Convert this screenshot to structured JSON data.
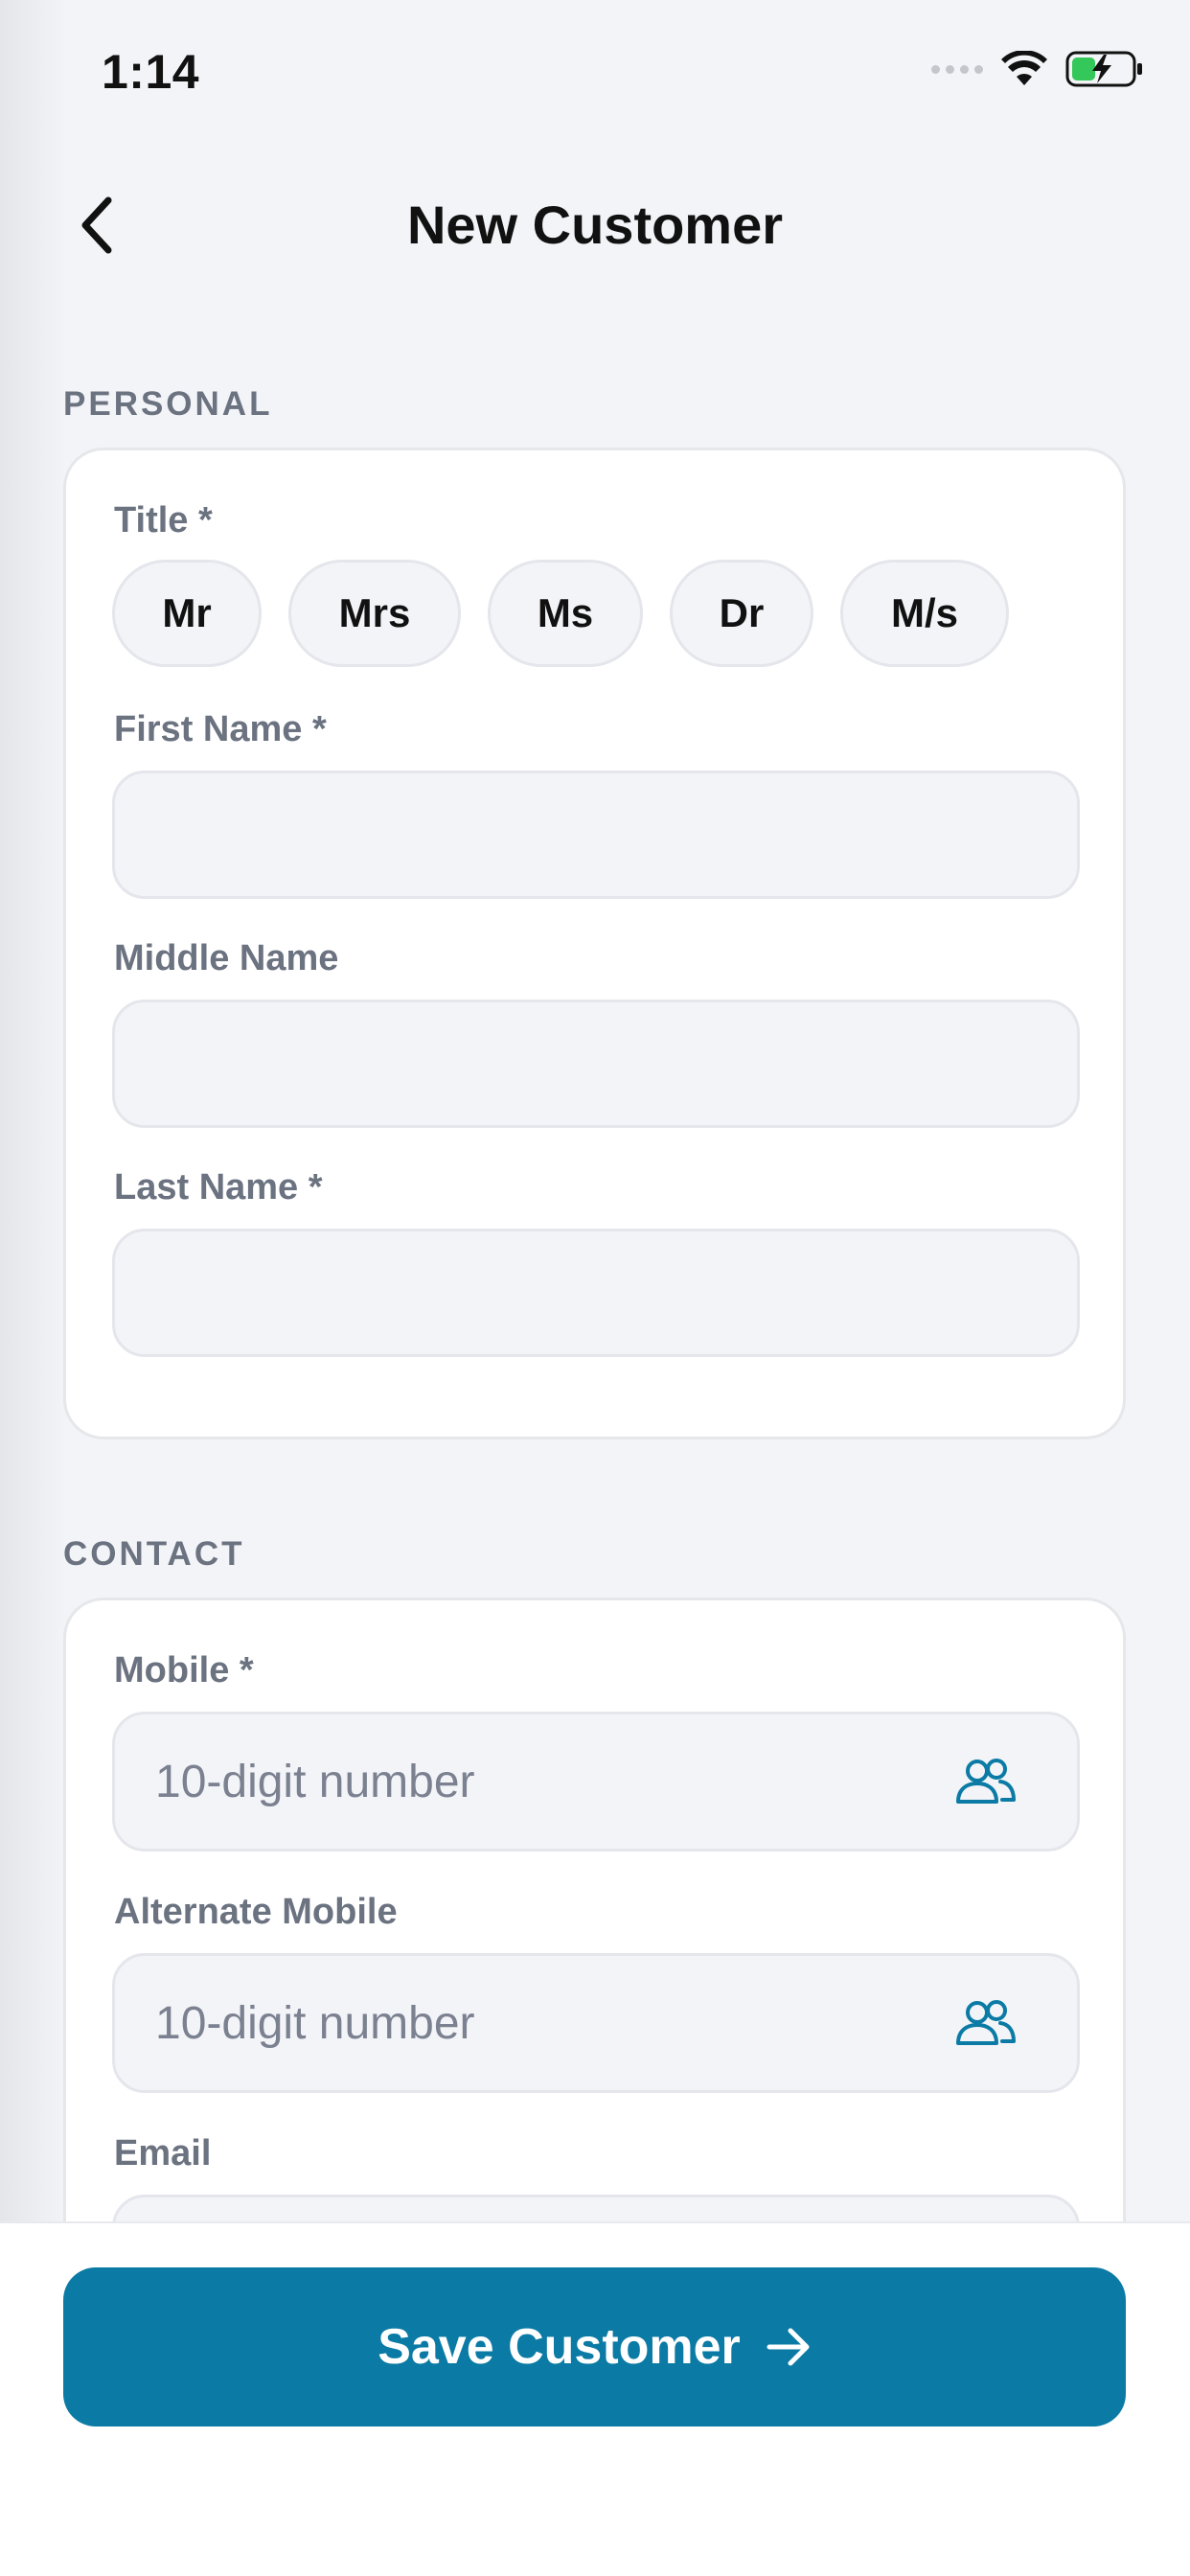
{
  "status_bar": {
    "time": "1:14"
  },
  "header": {
    "title": "New Customer",
    "back_icon": "chevron-left-icon"
  },
  "personal": {
    "section_label": "PERSONAL",
    "title_label": "Title *",
    "title_options": [
      "Mr",
      "Mrs",
      "Ms",
      "Dr",
      "M/s"
    ],
    "first_name_label": "First Name *",
    "first_name_value": "",
    "middle_name_label": "Middle Name",
    "middle_name_value": "",
    "last_name_label": "Last Name *",
    "last_name_value": ""
  },
  "contact": {
    "section_label": "CONTACT",
    "mobile_label": "Mobile *",
    "mobile_placeholder": "10-digit number",
    "alt_mobile_label": "Alternate Mobile",
    "alt_mobile_placeholder": "10-digit number",
    "email_label": "Email",
    "contacts_icon": "contacts-icon"
  },
  "footer": {
    "save_label": "Save Customer",
    "save_icon": "arrow-right-icon"
  },
  "colors": {
    "accent": "#0b7ba5",
    "background": "#f3f4f8",
    "label": "#6b7280",
    "battery_charge": "#34c759"
  }
}
